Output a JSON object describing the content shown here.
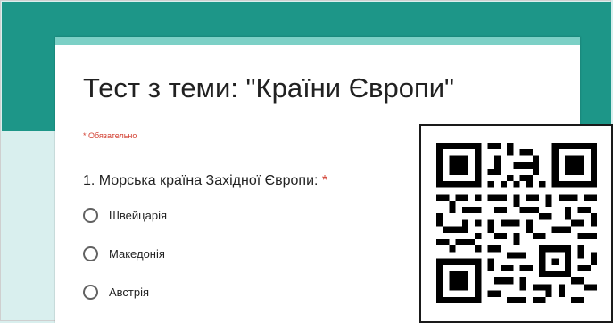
{
  "form": {
    "title": "Тест з теми: \"Країни Європи\"",
    "required_note": "* Обязательно",
    "question": {
      "number_text": "1. Морська країна Західної Європи:",
      "required_marker": "*",
      "options": [
        "Швейцарія",
        "Македонія",
        "Австрія"
      ]
    }
  },
  "colors": {
    "header_band": "#1d9688",
    "card_accent": "#7cd0c6",
    "page_background": "#d9efee",
    "required": "#d23f31"
  },
  "qr_code": {
    "icon": "qr-code-icon"
  }
}
